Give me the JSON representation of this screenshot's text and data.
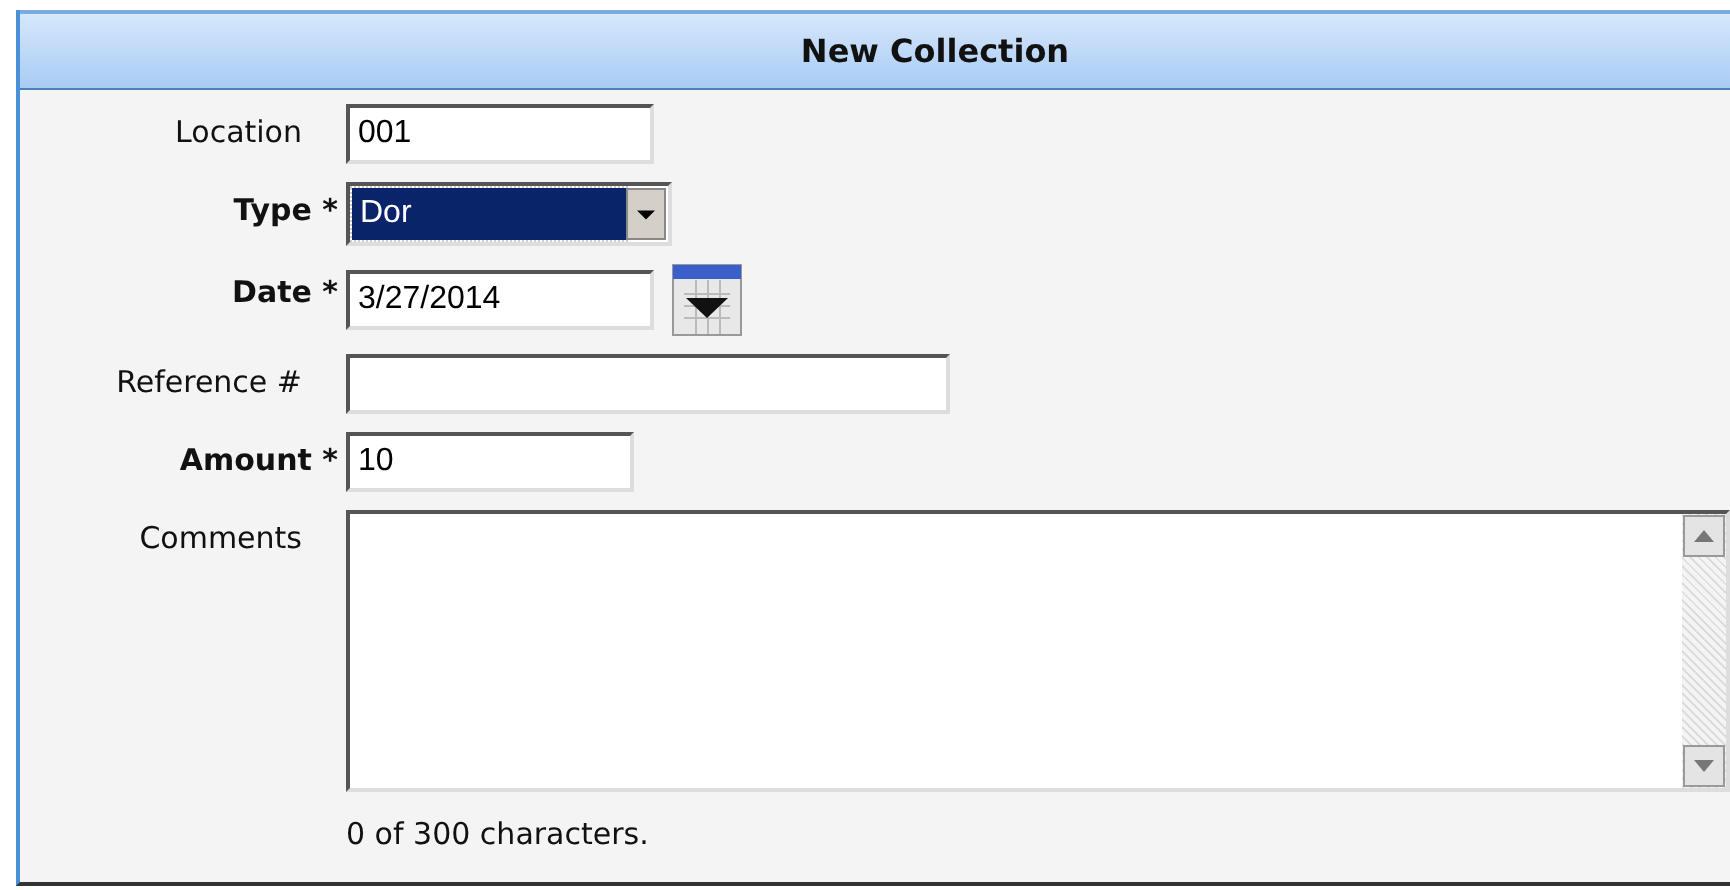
{
  "panel": {
    "title": "New Collection"
  },
  "fields": [
    {
      "kind": "text",
      "label": "Location",
      "required": false,
      "value": "001"
    },
    {
      "kind": "select",
      "label": "Type *",
      "required": true,
      "value": "Dor"
    },
    {
      "kind": "date",
      "label": "Date *",
      "required": true,
      "value": "3/27/2014"
    },
    {
      "kind": "wide",
      "label": "Reference #",
      "required": false
    },
    {
      "kind": "short",
      "label": "Amount *",
      "required": true,
      "value": "10"
    },
    {
      "kind": "textarea",
      "label": "Comments",
      "required": false,
      "counter": "0 of 300 characters."
    }
  ]
}
